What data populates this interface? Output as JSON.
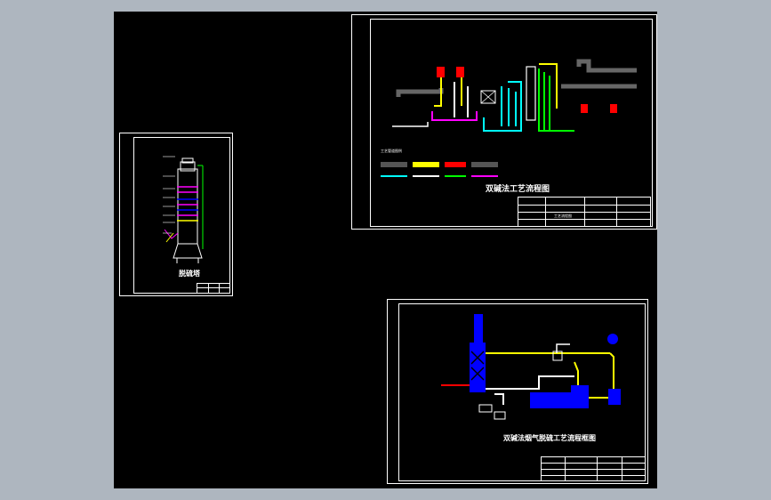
{
  "colors": {
    "background": "#aeb6bf",
    "canvas": "#000000",
    "line": "#ffffff",
    "gray": "#555555",
    "yellow": "#ffff00",
    "red": "#ff0000",
    "cyan": "#00ffff",
    "green": "#00ff00",
    "magenta": "#ff00ff",
    "blue": "#0000ff"
  },
  "sheets": {
    "tower": {
      "title": "脱硫塔"
    },
    "process": {
      "title": "双碱法工艺流程图",
      "legend_heading": "工艺管道图例",
      "titleblock_text": "工艺流程图"
    },
    "flue_gas": {
      "title": "双碱法烟气脱硫工艺流程框图"
    }
  }
}
